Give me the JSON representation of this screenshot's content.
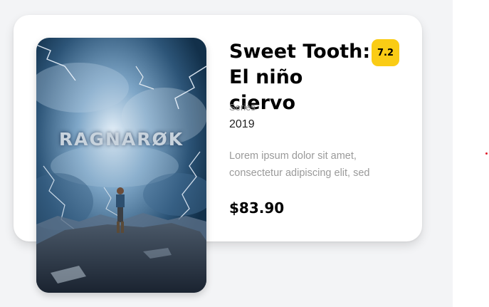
{
  "card": {
    "poster_title": "RAGNARØK",
    "title": "Sweet Tooth: El niño ciervo",
    "rating": "7.2",
    "type_label": "Series",
    "year": "2019",
    "description": "Lorem ipsum dolor sit amet, consectetur adipiscing elit, sed",
    "price": "$83.90"
  },
  "colors": {
    "rating_badge": "#facc15",
    "page_background": "#f3f4f6",
    "card_background": "#ffffff"
  }
}
